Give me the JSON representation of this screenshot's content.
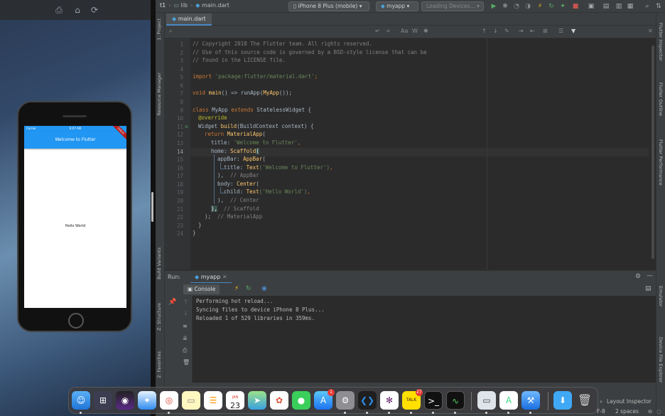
{
  "simulator": {
    "status_carrier": "Carrier",
    "status_time": "6:07 AM",
    "app_bar_title": "Welcome to Flutter",
    "body_text": "Hello World",
    "debug_banner": "DEBUG"
  },
  "toolbar": {
    "breadcrumb": [
      "t1",
      "lib",
      "main.dart"
    ],
    "device_selector": "iPhone 8 Plus (mobile)",
    "run_config": "myapp",
    "loading_devices": "Loading Devices..."
  },
  "editor": {
    "tab_label": "main.dart",
    "line_numbers": [
      "1",
      "2",
      "3",
      "4",
      "5",
      "6",
      "7",
      "8",
      "9",
      "10",
      "11",
      "12",
      "13",
      "14",
      "15",
      "16",
      "17",
      "18",
      "19",
      "20",
      "21",
      "22",
      "23",
      "24"
    ],
    "code": {
      "l1": "// Copyright 2018 The Flutter team. All rights reserved.",
      "l2": "// Use of this source code is governed by a BSD-style license that can be",
      "l3": "// found in the LICENSE file.",
      "l5_kw": "import",
      "l5_str": "'package:flutter/material.dart'",
      "l5_end": ";",
      "l7_kw": "void",
      "l7_fn": "main",
      "l7_rest": "() => runApp(",
      "l7_cls": "MyApp",
      "l7_end": "());",
      "l9_kw": "class",
      "l9_name": " MyApp ",
      "l9_kw2": "extends",
      "l9_rest": " StatelessWidget {",
      "l10": "@override",
      "l11_type": "Widget ",
      "l11_fn": "build",
      "l11_rest": "(BuildContext context) {",
      "l12_kw": "return",
      "l12_cls": " MaterialApp",
      "l12_end": "(",
      "l13_key": "title: ",
      "l13_str": "'Welcome to Flutter'",
      "l13_end": ",",
      "l14_key": "home: ",
      "l14_cls": "Scaffold",
      "l14_end": "(",
      "l15_key": "appBar: ",
      "l15_cls": "AppBar",
      "l15_end": "(",
      "l16_key": "title: ",
      "l16_cls": "Text",
      "l16_str": "('Welcome to Flutter')",
      "l16_end": ",",
      "l17_code": "),",
      "l17_cm": "  // AppBar",
      "l18_key": "body: ",
      "l18_cls": "Center",
      "l18_end": "(",
      "l19_key": "child: ",
      "l19_cls": "Text",
      "l19_str": "('Hello World')",
      "l19_end": ",",
      "l20_code": "),",
      "l20_cm": "  // Center",
      "l21_code": "),",
      "l21_cm": "  // Scaffold",
      "l22_code": ");",
      "l22_cm": "  // MaterialApp",
      "l23": "}",
      "l24": "}"
    }
  },
  "side_tabs_left": [
    "1: Project",
    "Resource Manager",
    "Build Variants",
    "Z: Structure",
    "2: Favorites"
  ],
  "side_tabs_right": [
    "Flutter Inspector",
    "Flutter Outline",
    "Flutter Performance",
    "Emulator",
    "Device File Explorer"
  ],
  "run_panel": {
    "label": "Run:",
    "tab": "myapp",
    "console_tab": "Console",
    "output": [
      "Performing hot reload...",
      "Syncing files to device iPhone 8 Plus...",
      "Reloaded 1 of 529 libraries in 359ms."
    ]
  },
  "status_bar": {
    "layout_inspector": "Layout Inspector",
    "encoding": "F-8",
    "indent": "2 spaces"
  },
  "dock": {
    "calendar_day": "23",
    "calendar_month": "JAN",
    "appstore_badge": "1",
    "talk_badge": "27",
    "talk_label": "TALK"
  },
  "colors": {
    "flutter_blue": "#2196f3",
    "ide_bg": "#2b2b2b",
    "ide_panel": "#3c3f41"
  }
}
